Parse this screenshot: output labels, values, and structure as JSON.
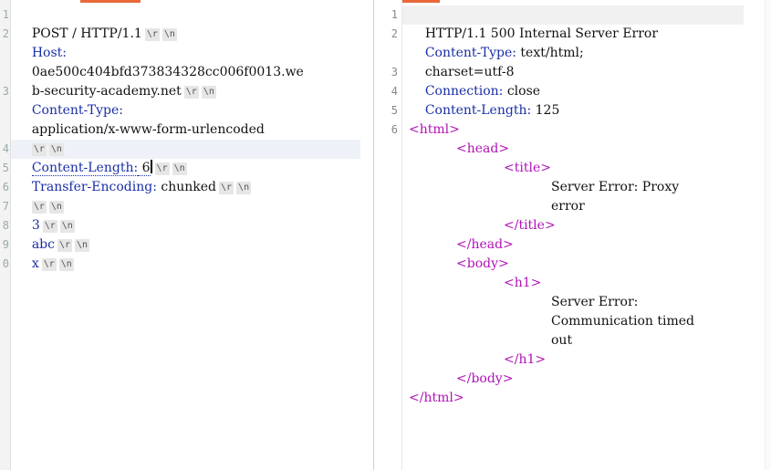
{
  "request": {
    "lines": [
      {
        "key": "",
        "text": "POST / HTTP/1.1"
      },
      {
        "key": "Host:",
        "text": ""
      },
      {
        "key": "",
        "text": "0ae500c404bfd373834328cc006f0013.we"
      },
      {
        "key": "",
        "text": "b-security-academy.net"
      },
      {
        "key": "Content-Type:",
        "text": ""
      },
      {
        "key": "",
        "text": "application/x-www-form-urlencoded"
      },
      {
        "key": "",
        "text": ""
      },
      {
        "key": "Content-Length:",
        "text": " 6"
      },
      {
        "key": "Transfer-Encoding:",
        "text": " chunked"
      },
      {
        "key": "",
        "text": ""
      },
      {
        "key": "",
        "text": "3"
      },
      {
        "key": "",
        "text": "abc"
      },
      {
        "key": "",
        "text": "x"
      }
    ],
    "crlf_label_r": "\\r",
    "crlf_label_n": "\\n"
  },
  "response": {
    "line_numbers": [
      "1",
      "2",
      "3",
      "4",
      "5",
      "6"
    ],
    "status_line": "HTTP/1.1 500 Internal Server Error",
    "ct_key": "Content-Type:",
    "ct_val": " text/html;",
    "ct_val2": "charset=utf-8",
    "conn_key": "Connection:",
    "conn_val": " close",
    "cl_key": "Content-Length:",
    "cl_val": " 125",
    "html": {
      "html_open": "<html>",
      "head_open": "<head>",
      "title_open": "<title>",
      "title_text_1": "Server Error: Proxy",
      "title_text_2": "error",
      "title_close": "</title>",
      "head_close": "</head>",
      "body_open": "<body>",
      "h1_open": "<h1>",
      "h1_text_1": "Server Error:",
      "h1_text_2": "Communication timed",
      "h1_text_3": "out",
      "h1_close": "</h1>",
      "body_close": "</body>",
      "html_close": "</html>"
    }
  }
}
